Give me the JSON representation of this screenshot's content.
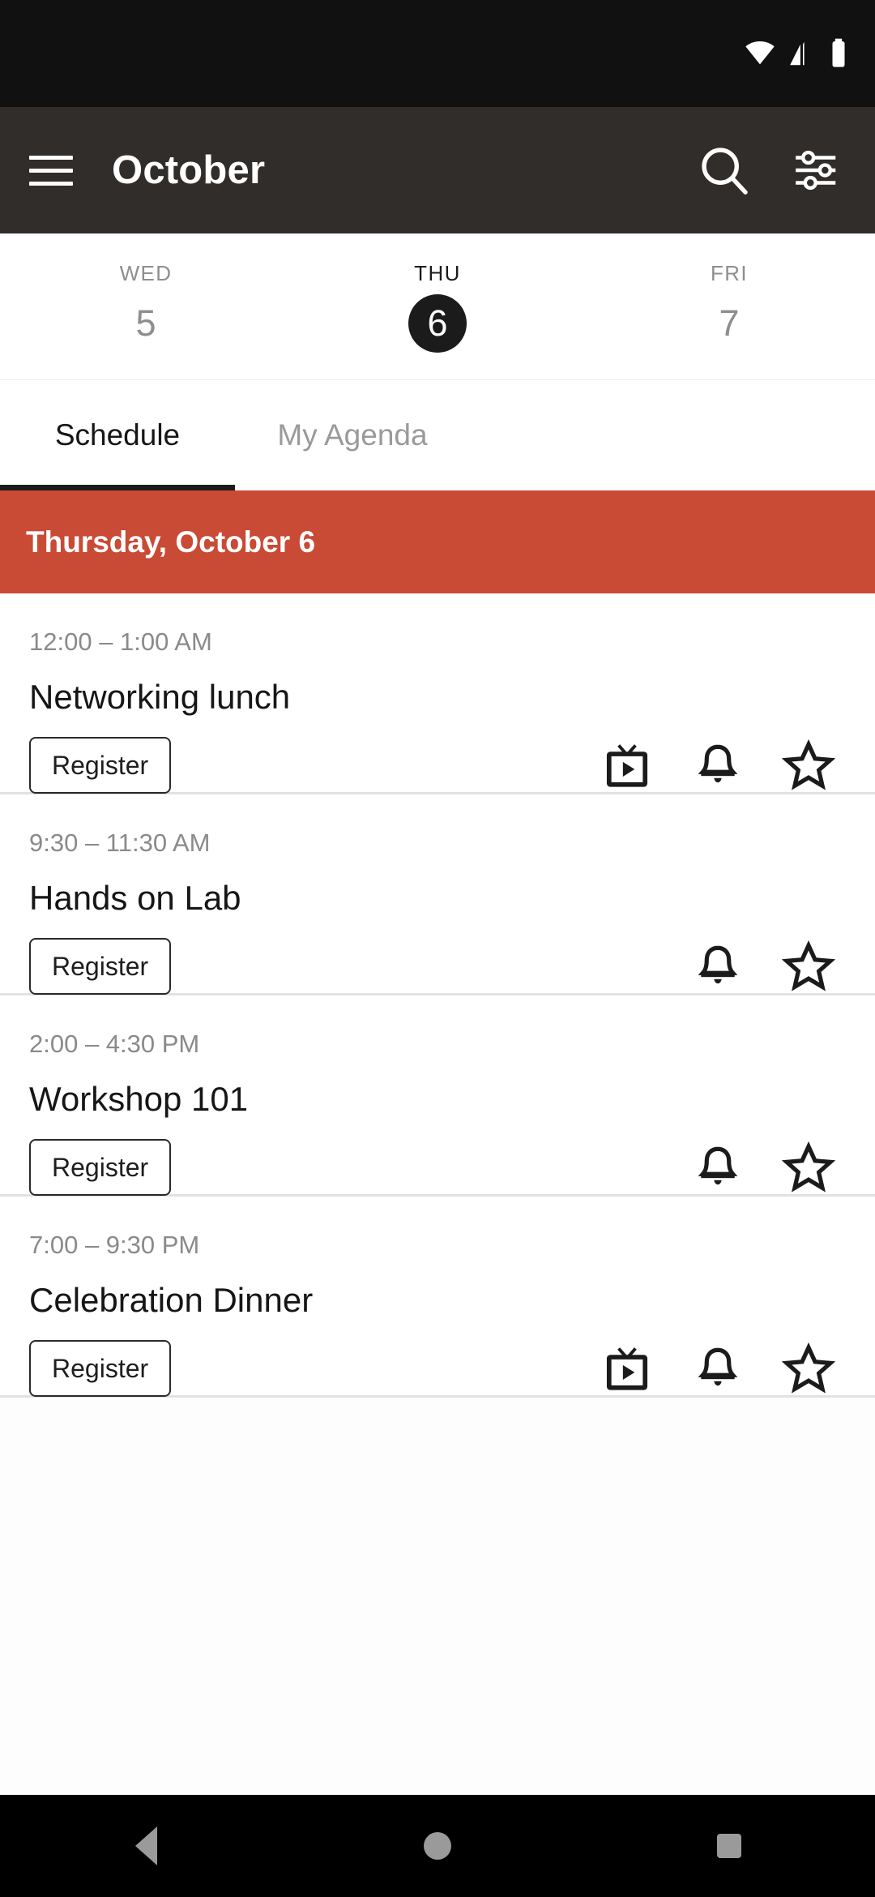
{
  "status_bar": {
    "icons": [
      "wifi-icon",
      "cellular-signal-icon",
      "battery-icon"
    ]
  },
  "app_bar": {
    "menu_icon": "hamburger-menu-icon",
    "title": "October",
    "search_icon": "search-icon",
    "filter_icon": "filter-tune-icon"
  },
  "date_strip": {
    "days": [
      {
        "dow": "WED",
        "num": "5",
        "selected": false
      },
      {
        "dow": "THU",
        "num": "6",
        "selected": true
      },
      {
        "dow": "FRI",
        "num": "7",
        "selected": false
      }
    ]
  },
  "tabs": [
    {
      "label": "Schedule",
      "active": true
    },
    {
      "label": "My Agenda",
      "active": false
    }
  ],
  "day_header": {
    "label": "Thursday, October 6",
    "background": "#C94A35"
  },
  "events": [
    {
      "time": "12:00 – 1:00 AM",
      "title": "Networking lunch",
      "register_label": "Register",
      "actions": [
        "livestream-tv-icon",
        "bell-reminder-icon",
        "star-favorite-icon"
      ]
    },
    {
      "time": "9:30 – 11:30 AM",
      "title": "Hands on Lab",
      "register_label": "Register",
      "actions": [
        "bell-reminder-icon",
        "star-favorite-icon"
      ]
    },
    {
      "time": "2:00 – 4:30 PM",
      "title": "Workshop 101",
      "register_label": "Register",
      "actions": [
        "bell-reminder-icon",
        "star-favorite-icon"
      ]
    },
    {
      "time": "7:00 – 9:30 PM",
      "title": "Celebration Dinner",
      "register_label": "Register",
      "actions": [
        "livestream-tv-icon",
        "bell-reminder-icon",
        "star-favorite-icon"
      ]
    }
  ],
  "nav_bar": {
    "back": "back-triangle-icon",
    "home": "home-circle-icon",
    "recents": "recents-square-icon"
  }
}
